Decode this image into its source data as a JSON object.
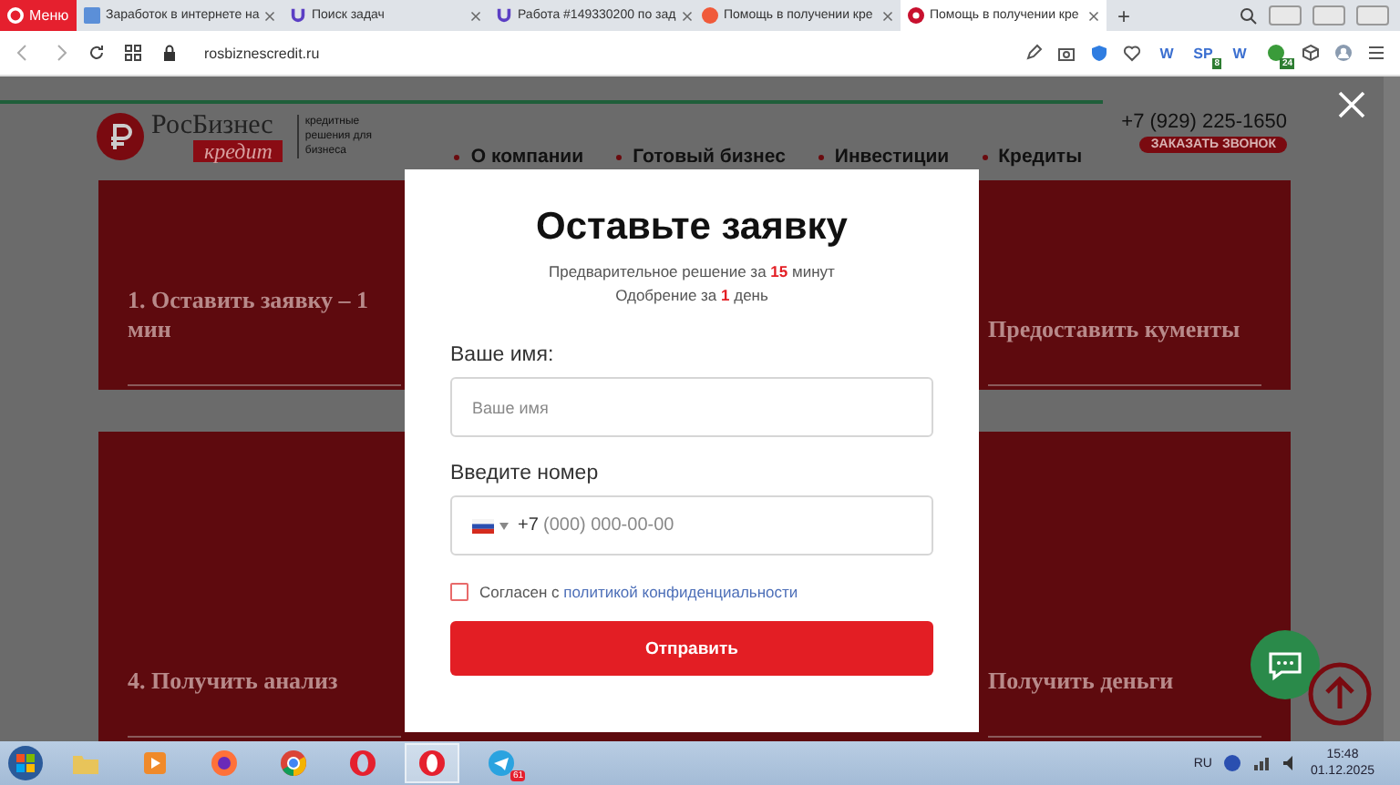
{
  "browser": {
    "menu_label": "Меню",
    "tabs": [
      {
        "label": "Заработок в интернете на",
        "selected": false
      },
      {
        "label": "Поиск задач",
        "selected": false
      },
      {
        "label": "Работа #149330200 по зад",
        "selected": false
      },
      {
        "label": "Помощь в получении кре",
        "selected": false
      },
      {
        "label": "Помощь в получении кре",
        "selected": true
      }
    ],
    "new_tab": "+",
    "url": "rosbiznescredit.ru",
    "extensions": [
      {
        "label": "W"
      },
      {
        "label": "SP",
        "badge": "8"
      },
      {
        "label": "W"
      },
      {
        "badge": "24"
      }
    ]
  },
  "site": {
    "logo": {
      "title": "РосБизнес",
      "subtitle": "кредит",
      "tagline": "кредитные решения для бизнеса"
    },
    "nav": [
      "О компании",
      "Готовый бизнес",
      "Инвестиции",
      "Кредиты"
    ],
    "phone": "+7 (929) 225-1650",
    "callback_button": "ЗАКАЗАТЬ ЗВОНОК",
    "steps_top": [
      {
        "text": "1. Оставить заявку – 1 мин"
      },
      {
        "text": "Предоставить кументы"
      }
    ],
    "steps_bottom": [
      {
        "text": "4. Получить анализ"
      },
      {
        "text": "Получить деньги"
      }
    ]
  },
  "modal": {
    "title": "Оставьте заявку",
    "lines": [
      "Предварительное решение за **15** минут",
      "Одобрение за **1** день"
    ],
    "name_label": "Ваше имя:",
    "name_placeholder": "Ваше имя",
    "phone_label": "Введите номер",
    "phone_code": "+7",
    "phone_placeholder": "(000) 000-00-00",
    "consent": {
      "checked": false,
      "text": "Согласен с",
      "link": "политикой конфиденциальности"
    },
    "submit": "Отправить"
  },
  "taskbar": {
    "language": "RU",
    "time": "15:48",
    "date": "01.12.2025",
    "telegram_badge": "61"
  }
}
